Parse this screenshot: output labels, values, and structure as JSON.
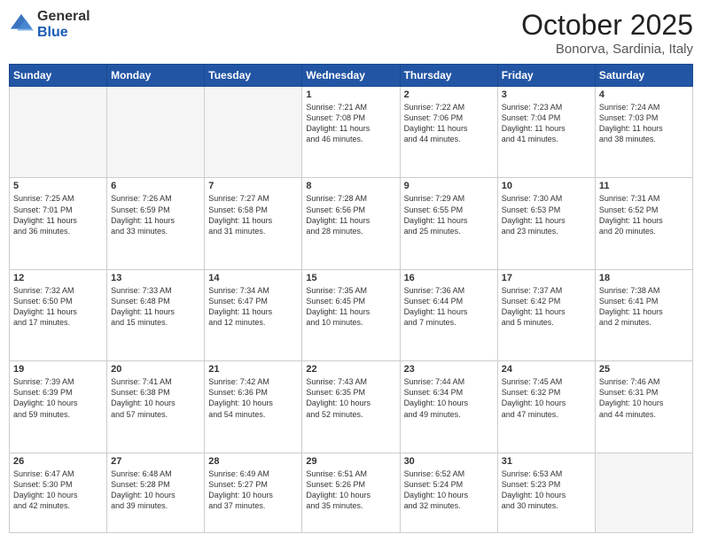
{
  "logo": {
    "general": "General",
    "blue": "Blue"
  },
  "header": {
    "month": "October 2025",
    "location": "Bonorva, Sardinia, Italy"
  },
  "days_of_week": [
    "Sunday",
    "Monday",
    "Tuesday",
    "Wednesday",
    "Thursday",
    "Friday",
    "Saturday"
  ],
  "weeks": [
    [
      {
        "day": "",
        "info": ""
      },
      {
        "day": "",
        "info": ""
      },
      {
        "day": "",
        "info": ""
      },
      {
        "day": "1",
        "info": "Sunrise: 7:21 AM\nSunset: 7:08 PM\nDaylight: 11 hours\nand 46 minutes."
      },
      {
        "day": "2",
        "info": "Sunrise: 7:22 AM\nSunset: 7:06 PM\nDaylight: 11 hours\nand 44 minutes."
      },
      {
        "day": "3",
        "info": "Sunrise: 7:23 AM\nSunset: 7:04 PM\nDaylight: 11 hours\nand 41 minutes."
      },
      {
        "day": "4",
        "info": "Sunrise: 7:24 AM\nSunset: 7:03 PM\nDaylight: 11 hours\nand 38 minutes."
      }
    ],
    [
      {
        "day": "5",
        "info": "Sunrise: 7:25 AM\nSunset: 7:01 PM\nDaylight: 11 hours\nand 36 minutes."
      },
      {
        "day": "6",
        "info": "Sunrise: 7:26 AM\nSunset: 6:59 PM\nDaylight: 11 hours\nand 33 minutes."
      },
      {
        "day": "7",
        "info": "Sunrise: 7:27 AM\nSunset: 6:58 PM\nDaylight: 11 hours\nand 31 minutes."
      },
      {
        "day": "8",
        "info": "Sunrise: 7:28 AM\nSunset: 6:56 PM\nDaylight: 11 hours\nand 28 minutes."
      },
      {
        "day": "9",
        "info": "Sunrise: 7:29 AM\nSunset: 6:55 PM\nDaylight: 11 hours\nand 25 minutes."
      },
      {
        "day": "10",
        "info": "Sunrise: 7:30 AM\nSunset: 6:53 PM\nDaylight: 11 hours\nand 23 minutes."
      },
      {
        "day": "11",
        "info": "Sunrise: 7:31 AM\nSunset: 6:52 PM\nDaylight: 11 hours\nand 20 minutes."
      }
    ],
    [
      {
        "day": "12",
        "info": "Sunrise: 7:32 AM\nSunset: 6:50 PM\nDaylight: 11 hours\nand 17 minutes."
      },
      {
        "day": "13",
        "info": "Sunrise: 7:33 AM\nSunset: 6:48 PM\nDaylight: 11 hours\nand 15 minutes."
      },
      {
        "day": "14",
        "info": "Sunrise: 7:34 AM\nSunset: 6:47 PM\nDaylight: 11 hours\nand 12 minutes."
      },
      {
        "day": "15",
        "info": "Sunrise: 7:35 AM\nSunset: 6:45 PM\nDaylight: 11 hours\nand 10 minutes."
      },
      {
        "day": "16",
        "info": "Sunrise: 7:36 AM\nSunset: 6:44 PM\nDaylight: 11 hours\nand 7 minutes."
      },
      {
        "day": "17",
        "info": "Sunrise: 7:37 AM\nSunset: 6:42 PM\nDaylight: 11 hours\nand 5 minutes."
      },
      {
        "day": "18",
        "info": "Sunrise: 7:38 AM\nSunset: 6:41 PM\nDaylight: 11 hours\nand 2 minutes."
      }
    ],
    [
      {
        "day": "19",
        "info": "Sunrise: 7:39 AM\nSunset: 6:39 PM\nDaylight: 10 hours\nand 59 minutes."
      },
      {
        "day": "20",
        "info": "Sunrise: 7:41 AM\nSunset: 6:38 PM\nDaylight: 10 hours\nand 57 minutes."
      },
      {
        "day": "21",
        "info": "Sunrise: 7:42 AM\nSunset: 6:36 PM\nDaylight: 10 hours\nand 54 minutes."
      },
      {
        "day": "22",
        "info": "Sunrise: 7:43 AM\nSunset: 6:35 PM\nDaylight: 10 hours\nand 52 minutes."
      },
      {
        "day": "23",
        "info": "Sunrise: 7:44 AM\nSunset: 6:34 PM\nDaylight: 10 hours\nand 49 minutes."
      },
      {
        "day": "24",
        "info": "Sunrise: 7:45 AM\nSunset: 6:32 PM\nDaylight: 10 hours\nand 47 minutes."
      },
      {
        "day": "25",
        "info": "Sunrise: 7:46 AM\nSunset: 6:31 PM\nDaylight: 10 hours\nand 44 minutes."
      }
    ],
    [
      {
        "day": "26",
        "info": "Sunrise: 6:47 AM\nSunset: 5:30 PM\nDaylight: 10 hours\nand 42 minutes."
      },
      {
        "day": "27",
        "info": "Sunrise: 6:48 AM\nSunset: 5:28 PM\nDaylight: 10 hours\nand 39 minutes."
      },
      {
        "day": "28",
        "info": "Sunrise: 6:49 AM\nSunset: 5:27 PM\nDaylight: 10 hours\nand 37 minutes."
      },
      {
        "day": "29",
        "info": "Sunrise: 6:51 AM\nSunset: 5:26 PM\nDaylight: 10 hours\nand 35 minutes."
      },
      {
        "day": "30",
        "info": "Sunrise: 6:52 AM\nSunset: 5:24 PM\nDaylight: 10 hours\nand 32 minutes."
      },
      {
        "day": "31",
        "info": "Sunrise: 6:53 AM\nSunset: 5:23 PM\nDaylight: 10 hours\nand 30 minutes."
      },
      {
        "day": "",
        "info": ""
      }
    ]
  ]
}
